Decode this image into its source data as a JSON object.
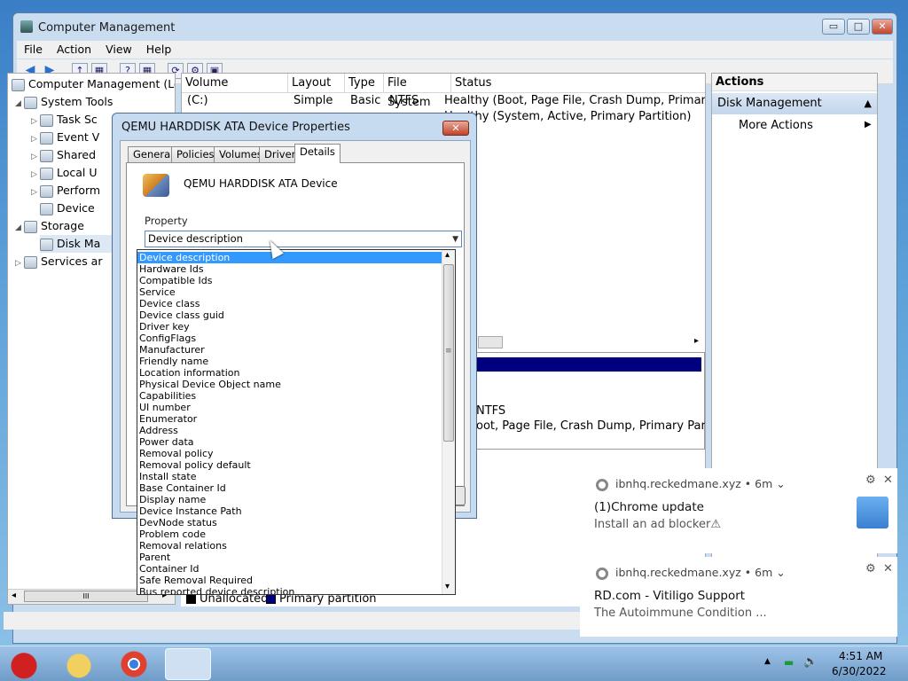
{
  "window": {
    "title": "Computer Management",
    "min": "▭",
    "max": "□",
    "close": "✕"
  },
  "menu": [
    "File",
    "Action",
    "View",
    "Help"
  ],
  "toolbar": [
    "◀",
    "▶",
    "↑",
    "▦",
    "?",
    "▦",
    "⟳",
    "⚙",
    "▣"
  ],
  "tree": [
    {
      "label": "Computer Management (Loca",
      "tog": "",
      "indent": 0
    },
    {
      "label": "System Tools",
      "tog": "◢",
      "indent": 1
    },
    {
      "label": "Task Sc",
      "tog": "▷",
      "indent": 2
    },
    {
      "label": "Event V",
      "tog": "▷",
      "indent": 2
    },
    {
      "label": "Shared",
      "tog": "▷",
      "indent": 2
    },
    {
      "label": "Local U",
      "tog": "▷",
      "indent": 2
    },
    {
      "label": "Perform",
      "tog": "▷",
      "indent": 2
    },
    {
      "label": "Device",
      "tog": "",
      "indent": 2
    },
    {
      "label": "Storage",
      "tog": "◢",
      "indent": 1
    },
    {
      "label": "Disk Ma",
      "tog": "",
      "indent": 2
    },
    {
      "label": "Services ar",
      "tog": "▷",
      "indent": 1
    }
  ],
  "tree_scroll": {
    "left": "◂",
    "thumb": "III",
    "right": "▸"
  },
  "columns": [
    "Volume",
    "Layout",
    "Type",
    "File System",
    "Status"
  ],
  "rows": [
    {
      "col1": "(C:)",
      "col2": "Simple",
      "col3": "Basic",
      "col4": "NTFS",
      "status": "Healthy (Boot, Page File, Crash Dump, Primary Part"
    },
    {
      "col1": "",
      "col2": "",
      "col3": "",
      "col4": "",
      "status": "Healthy (System, Active, Primary Partition)"
    }
  ],
  "scroll_right": "▸",
  "disk_detail": {
    "fs": "NTFS",
    "status": "oot, Page File, Crash Dump, Primary Partition"
  },
  "legend": {
    "unallocated": "Unallocated",
    "primary": "Primary partition"
  },
  "actions": {
    "header": "Actions",
    "section": "Disk Management",
    "section_arrow": "▲",
    "more": "More Actions",
    "more_arrow": "▶"
  },
  "dialog": {
    "title": "QEMU HARDDISK ATA Device Properties",
    "close": "✕",
    "tabs": [
      "General",
      "Policies",
      "Volumes",
      "Driver",
      "Details"
    ],
    "active_tab": "Details",
    "device_name": "QEMU HARDDISK ATA Device",
    "property_label": "Property",
    "combo_value": "Device description",
    "combo_arrow": "▼"
  },
  "dropdown": {
    "selected": "Device description",
    "options": [
      "Device description",
      "Hardware Ids",
      "Compatible Ids",
      "Service",
      "Device class",
      "Device class guid",
      "Driver key",
      "ConfigFlags",
      "Manufacturer",
      "Friendly name",
      "Location information",
      "Physical Device Object name",
      "Capabilities",
      "UI number",
      "Enumerator",
      "Address",
      "Power data",
      "Removal policy",
      "Removal policy default",
      "Install state",
      "Base Container Id",
      "Display name",
      "Device Instance Path",
      "DevNode status",
      "Problem code",
      "Removal relations",
      "Parent",
      "Container Id",
      "Safe Removal Required",
      "Bus reported device description"
    ],
    "scroll_up": "▴",
    "scroll_down": "▾",
    "grip": "≡"
  },
  "notifications": [
    {
      "site": "ibnhq.reckedmane.xyz",
      "time": "• 6m ⌄",
      "title": "(1)Chrome update",
      "message": "Install an ad blocker⚠"
    },
    {
      "site": "ibnhq.reckedmane.xyz",
      "time": "• 6m ⌄",
      "title": "RD.com - Vitiligo Support",
      "message": "The Autoimmune Condition ..."
    }
  ],
  "notif_controls": {
    "settings": "⚙",
    "close": "✕"
  },
  "taskbar": {
    "time": "4:51 AM",
    "date": "6/30/2022",
    "tray_up": "▲",
    "tray_net": "▬",
    "tray_vol": "🔈"
  }
}
